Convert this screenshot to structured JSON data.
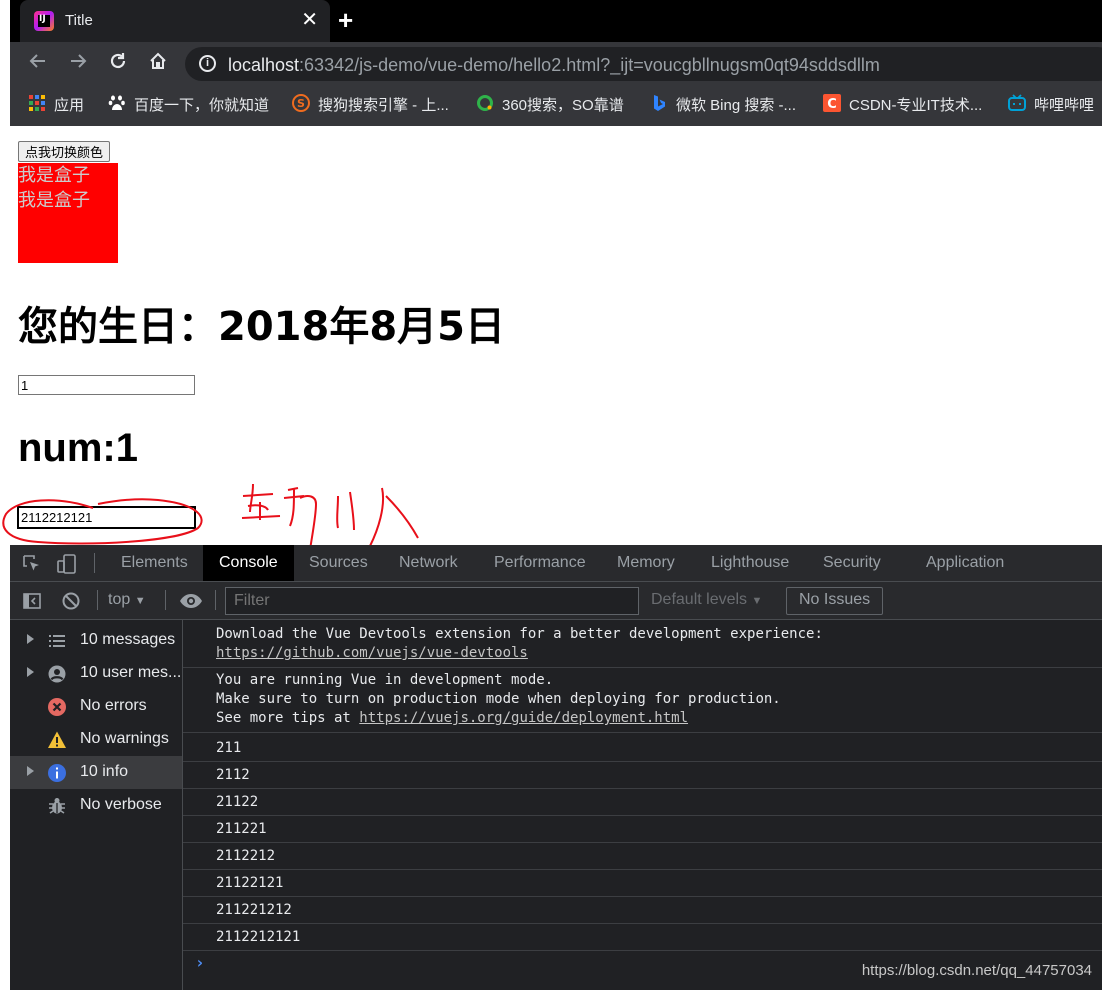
{
  "browser": {
    "tab_title": "Title",
    "tab_favicon_text": "IJ",
    "tab_close_glyph": "✕",
    "new_tab_glyph": "+",
    "url_host": "localhost",
    "url_rest": ":63342/js-demo/vue-demo/hello2.html?_ijt=voucgbllnugsm0qt94sddsdllm",
    "bookmarks": [
      {
        "label": "应用",
        "icon": "apps-grid-icon"
      },
      {
        "label": "百度一下，你就知道",
        "icon": "baidu-paw-icon"
      },
      {
        "label": "搜狗搜索引擎 - 上...",
        "icon": "sogou-icon"
      },
      {
        "label": "360搜索，SO靠谱",
        "icon": "360-search-icon"
      },
      {
        "label": "微软 Bing 搜索 -...",
        "icon": "bing-icon"
      },
      {
        "label": "CSDN-专业IT技术...",
        "icon": "csdn-icon"
      },
      {
        "label": "哔哩哔哩",
        "icon": "bilibili-tv-icon"
      }
    ]
  },
  "page": {
    "toggle_button": "点我切换颜色",
    "box_lines": [
      "我是盒子",
      "我是盒子"
    ],
    "box_color": "#ff0000",
    "birthday_heading": "您的生日：2018年8月5日",
    "num_input_value": "1",
    "num_heading": "num:1",
    "text_input_value": "2112212121"
  },
  "devtools": {
    "tabs": [
      "Elements",
      "Console",
      "Sources",
      "Network",
      "Performance",
      "Memory",
      "Lighthouse",
      "Security",
      "Application"
    ],
    "active_tab": "Console",
    "context": "top",
    "filter_placeholder": "Filter",
    "levels": "Default levels",
    "issues": "No Issues",
    "sidebar": [
      {
        "label": "10 messages",
        "icon": "list-icon",
        "expandable": true
      },
      {
        "label": "10 user mes...",
        "icon": "user-icon",
        "expandable": true
      },
      {
        "label": "No errors",
        "icon": "error-icon",
        "expandable": false
      },
      {
        "label": "No warnings",
        "icon": "warning-icon",
        "expandable": false
      },
      {
        "label": "10 info",
        "icon": "info-icon",
        "expandable": true
      },
      {
        "label": "No verbose",
        "icon": "bug-icon",
        "expandable": false
      }
    ],
    "messages": {
      "devtools_text": "Download the Vue Devtools extension for a better development experience:",
      "devtools_link": "https://github.com/vuejs/vue-devtools",
      "dev_mode_1": "You are running Vue in development mode.",
      "dev_mode_2": "Make sure to turn on production mode when deploying for production.",
      "dev_mode_3_prefix": "See more tips at ",
      "dev_mode_3_link": "https://vuejs.org/guide/deployment.html",
      "logs": [
        "211",
        "2112",
        "21122",
        "211221",
        "2112212",
        "21122121",
        "211221212",
        "2112212121"
      ]
    },
    "prompt_glyph": "›"
  },
  "watermark": "https://blog.csdn.net/qq_44757034",
  "colors": {
    "devtools_bg": "#202124",
    "console_link": "#c5c5c5",
    "annotation_ink": "#e8101a"
  }
}
